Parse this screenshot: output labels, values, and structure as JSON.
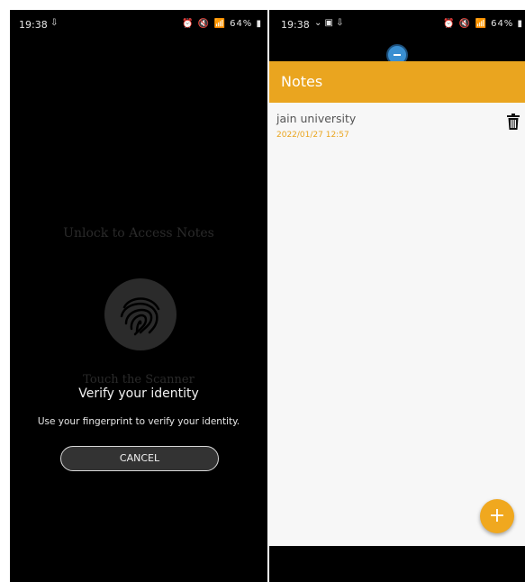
{
  "left_screen": {
    "status_bar": {
      "time": "19:38",
      "icons_text": "64%"
    },
    "lock_title": "Unlock to Access Notes",
    "touch_text": "Touch the Scanner",
    "verify_title": "Verify your identity",
    "verify_hint": "Use your fingerprint to verify your identity.",
    "cancel_label": "CANCEL"
  },
  "right_screen": {
    "status_bar": {
      "time": "19:38",
      "icons_text": "64%"
    },
    "app_title": "Notes",
    "notes": [
      {
        "title": "jain university",
        "date": "2022/01/27 12:57"
      }
    ],
    "fab_label": "+",
    "colors": {
      "accent": "#eaa51f",
      "background": "#f7f7f7"
    }
  }
}
